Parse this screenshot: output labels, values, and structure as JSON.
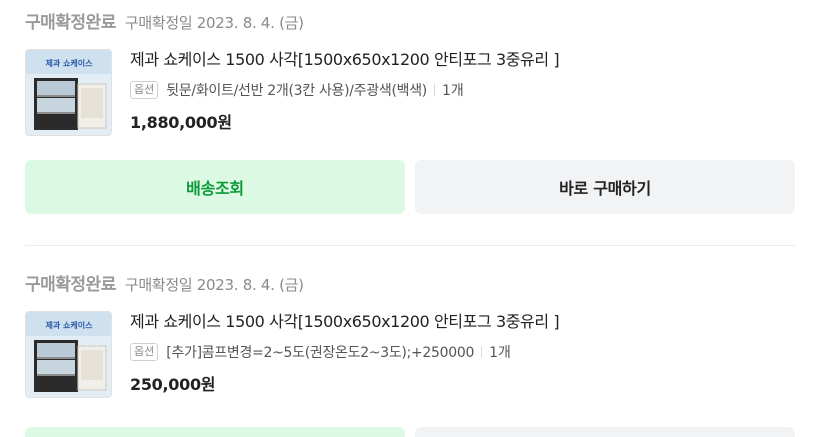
{
  "orders": [
    {
      "status": "구매확정완료",
      "date": "구매확정일 2023. 8. 4. (금)",
      "title": "제과 쇼케이스 1500 사각[1500x650x1200 안티포그 3중유리 ]",
      "option_badge": "옵션",
      "option_text": "뒷문/화이트/선반 2개(3칸 사용)/주광색(백색)",
      "qty": "1개",
      "price": "1,880,000원",
      "thumb_label": "제과 쇼케이스",
      "buttons": {
        "track": "배송조회",
        "buy_again": "바로 구매하기"
      }
    },
    {
      "status": "구매확정완료",
      "date": "구매확정일 2023. 8. 4. (금)",
      "title": "제과 쇼케이스 1500 사각[1500x650x1200 안티포그 3중유리 ]",
      "option_badge": "옵션",
      "option_text": "[추가]콤프변경=2~5도(권장온도2~3도);+250000",
      "qty": "1개",
      "price": "250,000원",
      "thumb_label": "제과 쇼케이스"
    }
  ],
  "colors": {
    "track_bg": "#dcf9e3",
    "track_text": "#0b9b3a",
    "buy_bg": "#f2f3f5"
  }
}
